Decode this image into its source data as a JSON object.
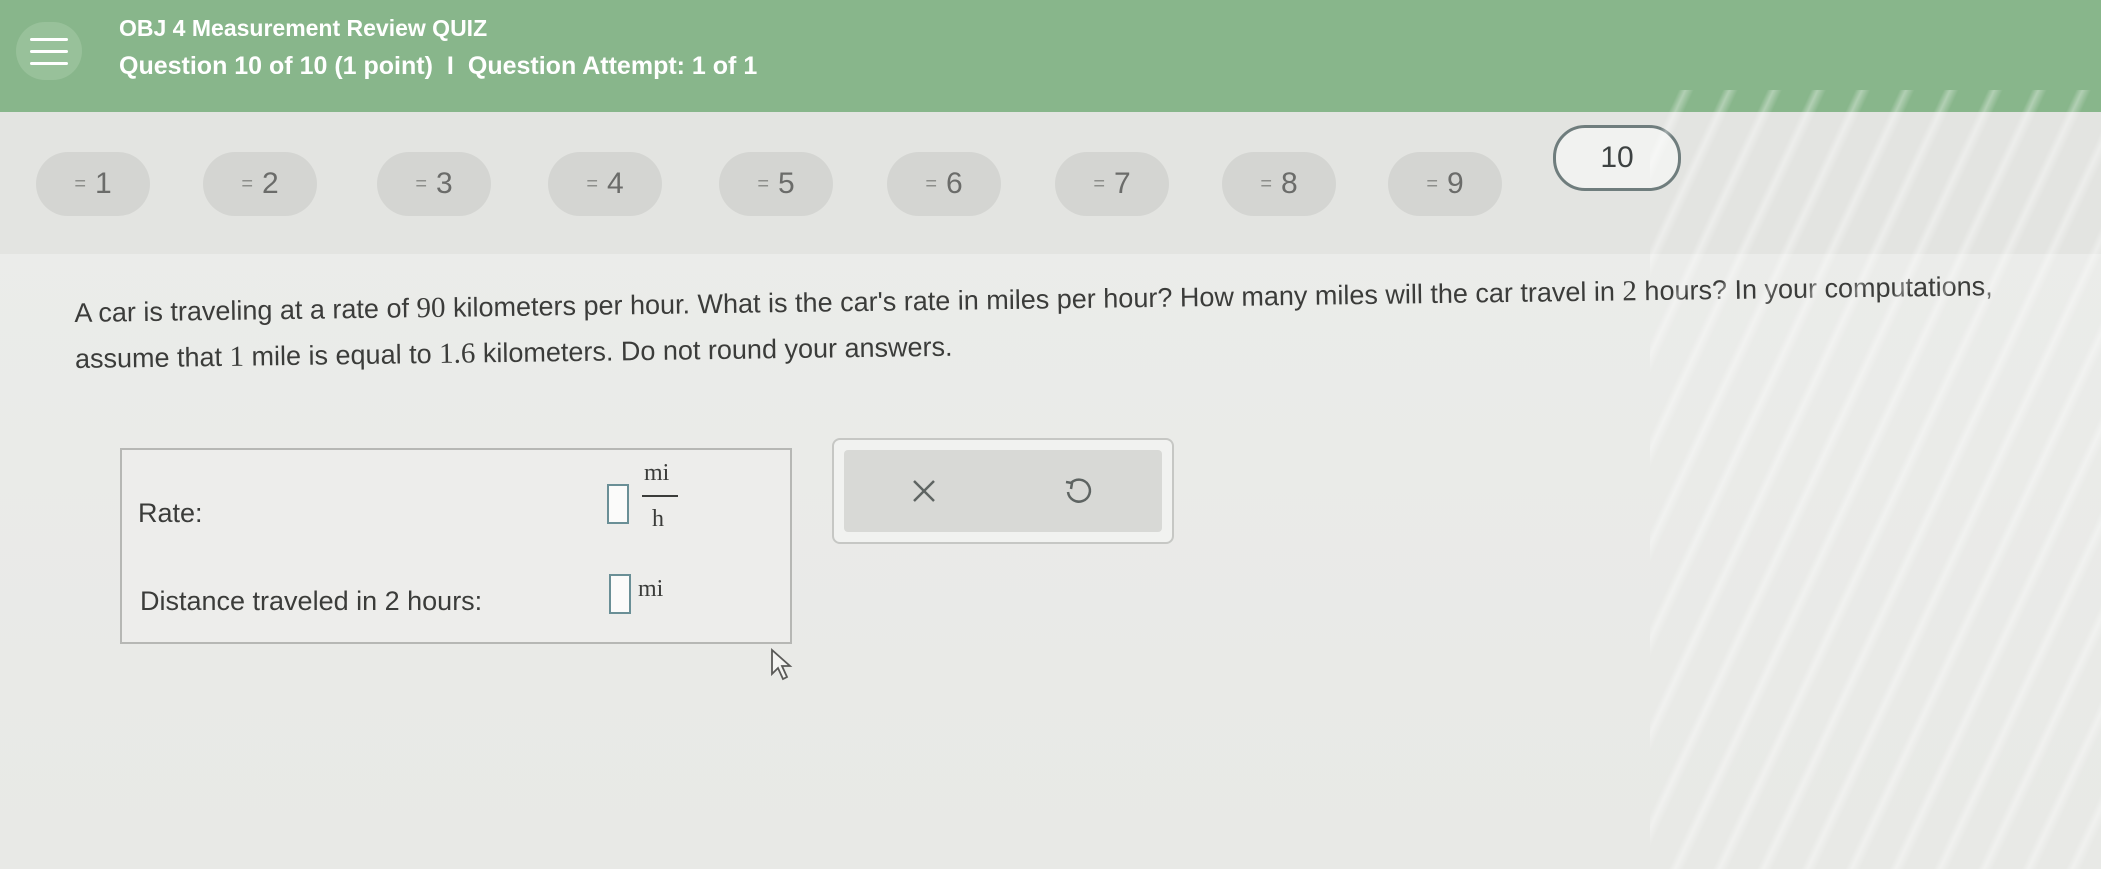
{
  "header": {
    "title": "OBJ 4 Measurement Review QUIZ",
    "question_progress": "Question 10 of 10 (1 point)",
    "separator": "I",
    "attempt": "Question Attempt: 1 of 1"
  },
  "nav": {
    "questions": [
      {
        "label": "1",
        "status": "answered"
      },
      {
        "label": "2",
        "status": "answered"
      },
      {
        "label": "3",
        "status": "answered"
      },
      {
        "label": "4",
        "status": "answered"
      },
      {
        "label": "5",
        "status": "answered"
      },
      {
        "label": "6",
        "status": "answered"
      },
      {
        "label": "7",
        "status": "answered"
      },
      {
        "label": "8",
        "status": "answered"
      },
      {
        "label": "9",
        "status": "answered"
      },
      {
        "label": "10",
        "status": "current"
      }
    ]
  },
  "question": {
    "part1": "A car is traveling at a rate of ",
    "rate_value": "90",
    "part2": " kilometers per hour. What is the car's rate in miles per hour? How many miles will the car travel in ",
    "hours_value": "2",
    "part3": " hours? In your computations, assume that ",
    "mile_value": "1",
    "part4": " mile is equal to ",
    "km_value": "1.6",
    "part5": " kilometers. Do not round your answers."
  },
  "answers": {
    "rate_label": "Rate:",
    "rate_value": "",
    "rate_unit_numerator": "mi",
    "rate_unit_denominator": "h",
    "distance_label": "Distance traveled in 2 hours:",
    "distance_value": "",
    "distance_unit": "mi"
  },
  "tools": {
    "clear_icon": "close-icon",
    "undo_icon": "undo-icon"
  },
  "colors": {
    "header_bg": "#88b68b",
    "page_bg": "#ececea",
    "active_border": "#6f7d7d"
  }
}
